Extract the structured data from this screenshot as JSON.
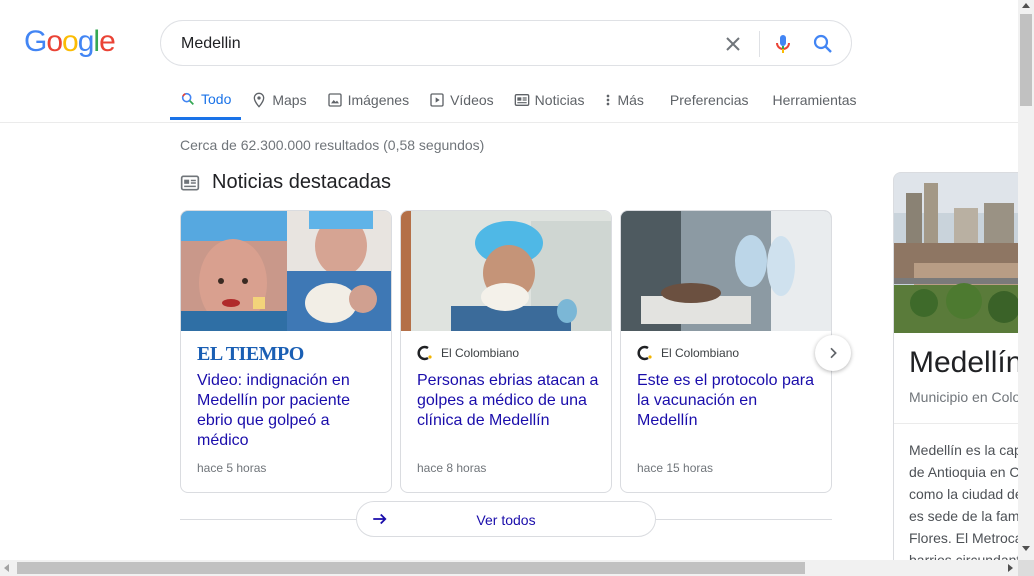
{
  "logo": {
    "letters": [
      "G",
      "o",
      "o",
      "g",
      "l",
      "e"
    ],
    "colors": [
      "#4285f4",
      "#ea4335",
      "#fbbc05",
      "#4285f4",
      "#34a853",
      "#ea4335"
    ]
  },
  "search": {
    "query": "Medellin"
  },
  "tabs": [
    {
      "label": "Todo",
      "icon": "search-icon",
      "active": true
    },
    {
      "label": "Maps",
      "icon": "map-pin-icon"
    },
    {
      "label": "Imágenes",
      "icon": "image-icon"
    },
    {
      "label": "Vídeos",
      "icon": "play-icon"
    },
    {
      "label": "Noticias",
      "icon": "news-icon"
    },
    {
      "label": "Más",
      "icon": "more-vert-icon"
    },
    {
      "label": "Preferencias"
    },
    {
      "label": "Herramientas"
    }
  ],
  "stats": "Cerca de 62.300.000 resultados (0,58 segundos)",
  "top_stories": {
    "heading": "Noticias destacadas",
    "cards": [
      {
        "source": "EL TIEMPO",
        "headline": "Video: indignación en Medellín por paciente ebrio que golpeó a médico",
        "time": "hace 5 horas"
      },
      {
        "source": "El Colombiano",
        "headline": "Personas ebrias atacan a golpes a médico de una clínica de Medellín",
        "time": "hace 8 horas"
      },
      {
        "source": "El Colombiano",
        "headline": "Este es el protocolo para la vacunación en Medellín",
        "time": "hace 15 horas"
      }
    ],
    "view_all": "Ver todos"
  },
  "knowledge_panel": {
    "title": "Medellín",
    "subtitle": "Municipio en Colombia",
    "description": "Medellín es la capital del departamento de Antioquia en Colombia. Conocida como la ciudad de la eterna primavera\", es sede de la famosa Feria de las Flores. El Metrocable conecta los barrios circundantes y tiene"
  },
  "colors": {
    "link": "#1a0dab",
    "accent": "#1a73e8"
  }
}
